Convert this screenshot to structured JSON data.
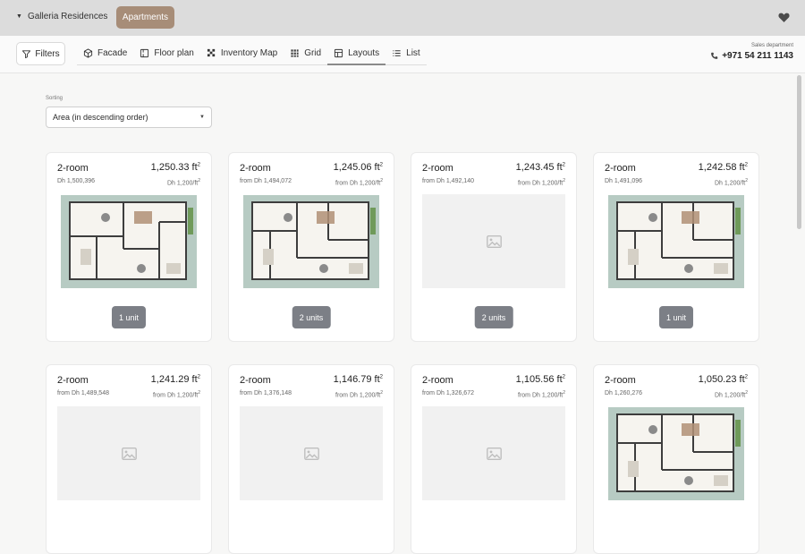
{
  "header": {
    "project": "Galleria Residences",
    "active_section": "Apartments"
  },
  "toolbar": {
    "filters_label": "Filters",
    "tabs": [
      {
        "label": "Facade",
        "icon": "cube-icon"
      },
      {
        "label": "Floor plan",
        "icon": "floor-plan-icon"
      },
      {
        "label": "Inventory Map",
        "icon": "inventory-map-icon"
      },
      {
        "label": "Grid",
        "icon": "grid-icon"
      },
      {
        "label": "Layouts",
        "icon": "layouts-icon",
        "active": true
      },
      {
        "label": "List",
        "icon": "list-icon"
      }
    ],
    "sales_label": "Sales department",
    "sales_phone": "+971 54 211 1143"
  },
  "sorting": {
    "label": "Sorting",
    "value": "Area (in descending order)"
  },
  "cards": [
    {
      "rooms": "2-room",
      "area": "1,250.33 ft",
      "price": "Dh 1,500,396",
      "psf": "Dh 1,200/ft",
      "has_plan": true,
      "units": "1 unit"
    },
    {
      "rooms": "2-room",
      "area": "1,245.06 ft",
      "price": "from Dh 1,494,072",
      "psf": "from Dh 1,200/ft",
      "has_plan": true,
      "units": "2 units"
    },
    {
      "rooms": "2-room",
      "area": "1,243.45 ft",
      "price": "from Dh 1,492,140",
      "psf": "from Dh 1,200/ft",
      "has_plan": false,
      "units": "2 units"
    },
    {
      "rooms": "2-room",
      "area": "1,242.58 ft",
      "price": "Dh 1,491,096",
      "psf": "Dh 1,200/ft",
      "has_plan": true,
      "units": "1 unit"
    },
    {
      "rooms": "2-room",
      "area": "1,241.29 ft",
      "price": "from Dh 1,489,548",
      "psf": "from Dh 1,200/ft",
      "has_plan": false,
      "units": ""
    },
    {
      "rooms": "2-room",
      "area": "1,146.79 ft",
      "price": "from Dh 1,376,148",
      "psf": "from Dh 1,200/ft",
      "has_plan": false,
      "units": ""
    },
    {
      "rooms": "2-room",
      "area": "1,105.56 ft",
      "price": "from Dh 1,326,672",
      "psf": "from Dh 1,200/ft",
      "has_plan": false,
      "units": ""
    },
    {
      "rooms": "2-room",
      "area": "1,050.23 ft",
      "price": "Dh 1,260,276",
      "psf": "Dh 1,200/ft",
      "has_plan": true,
      "units": ""
    }
  ],
  "colors": {
    "accent": "#a78d78",
    "units_badge": "#7c7f86",
    "plan_background": "#b7cbc3"
  }
}
